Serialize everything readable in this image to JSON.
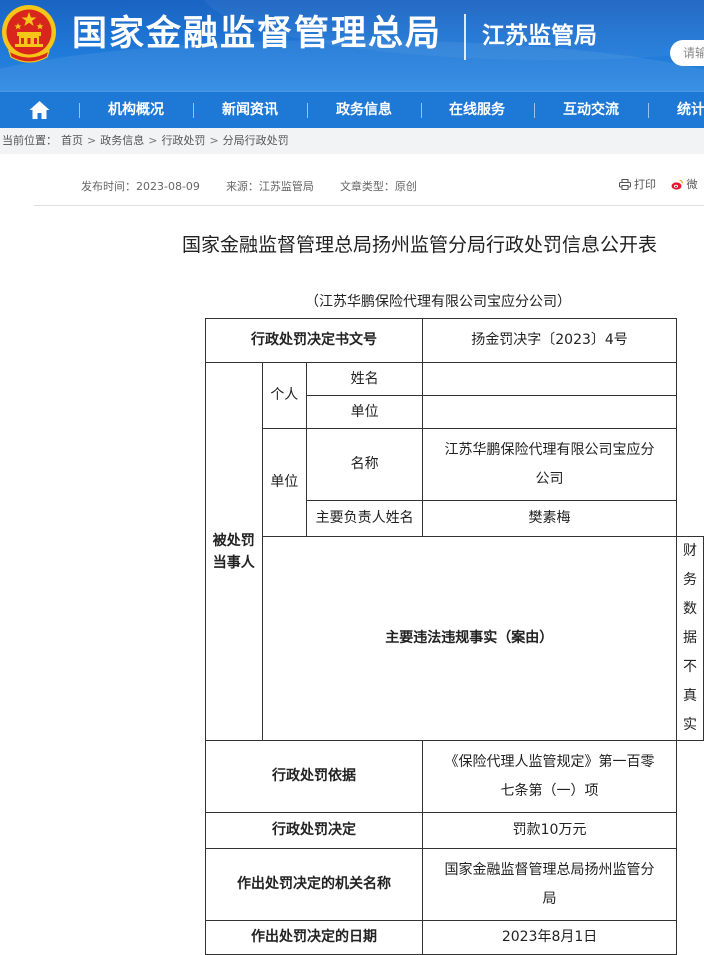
{
  "header": {
    "site_title": "国家金融监督管理总局",
    "branch_name": "江苏监管局",
    "search_placeholder": "请输"
  },
  "nav": {
    "items": [
      "机构概况",
      "新闻资讯",
      "政务信息",
      "在线服务",
      "互动交流",
      "统计"
    ]
  },
  "breadcrumb": {
    "label": "当前位置：",
    "items": [
      "首页",
      "政务信息",
      "行政处罚",
      "分局行政处罚"
    ],
    "separator": ">"
  },
  "meta": {
    "publish_time": "发布时间：2023-08-09",
    "source": "来源：江苏监管局",
    "type": "文章类型：原创"
  },
  "tools": {
    "print": "打印",
    "weibo": "微"
  },
  "article": {
    "title": "国家金融监督管理总局扬州监管分局行政处罚信息公开表",
    "party_caption": "（江苏华鹏保险代理有限公司宝应分公司）"
  },
  "table": {
    "decision_no_label": "行政处罚决定书文号",
    "decision_no_value": "扬金罚决字〔2023〕4号",
    "party_label_line1": "被处罚",
    "party_label_line2": "当事人",
    "individual_label": "个人",
    "name_label": "姓名",
    "name_value": "",
    "work_unit_label": "单位",
    "work_unit_value": "",
    "entity_label": "单位",
    "entity_name_label": "名称",
    "entity_name_line1": "江苏华鹏保险代理有限公司宝应分",
    "entity_name_line2": "公司",
    "principal_label": "主要负责人姓名",
    "principal_value": "樊素梅",
    "facts_label": "主要违法违规事实（案由）",
    "facts_value": "财务数据不真实",
    "basis_label": "行政处罚依据",
    "basis_line1": "《保险代理人监管规定》第一百零",
    "basis_line2": "七条第（一）项",
    "decision_label": "行政处罚决定",
    "decision_value": "罚款10万元",
    "authority_label": "作出处罚决定的机关名称",
    "authority_line1": "国家金融监督管理总局扬州监管分",
    "authority_line2": "局",
    "date_label": "作出处罚决定的日期",
    "date_value": "2023年8月1日"
  },
  "colors": {
    "header_blue": "#1f79d8",
    "nav_blue": "#1e78d6",
    "emblem_red": "#d9261c",
    "emblem_gold": "#f5c518"
  }
}
